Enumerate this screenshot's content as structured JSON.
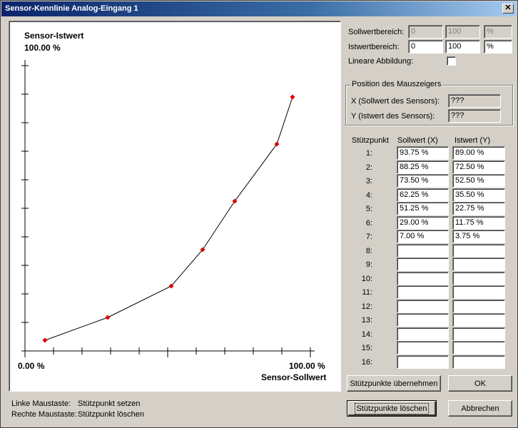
{
  "window": {
    "title": "Sensor-Kennlinie Analog-Eingang 1",
    "close_glyph": "✕"
  },
  "chart_data": {
    "type": "line",
    "title": "",
    "ylabel": "Sensor-Istwert",
    "xlabel": "Sensor-Sollwert",
    "y_top_label": "100.00 %",
    "x_min_label": "0.00 %",
    "x_max_label": "100.00 %",
    "xlim": [
      0,
      100
    ],
    "ylim": [
      0,
      100
    ],
    "grid": false,
    "marker_color": "#e00000",
    "line_color": "#000000",
    "series": [
      {
        "x": [
          93.75,
          88.25,
          73.5,
          62.25,
          51.25,
          29.0,
          7.0
        ],
        "y": [
          89.0,
          72.5,
          52.5,
          35.5,
          22.75,
          11.75,
          3.75
        ]
      }
    ]
  },
  "ranges": {
    "soll_label": "Sollwertbereich:",
    "soll_from": "0",
    "soll_to": "100",
    "soll_unit": "%",
    "ist_label": "Istwertbereich:",
    "ist_from": "0",
    "ist_to": "100",
    "ist_unit": "%",
    "linear_label": "Lineare Abbildung:"
  },
  "mouse": {
    "caption": "Position des Mauszeigers",
    "x_label": "X  (Sollwert des Sensors):",
    "x_value": "???",
    "y_label": "Y  (Istwert des Sensors):",
    "y_value": "???"
  },
  "points": {
    "col_index": "Stützpunkt",
    "col_x": "Sollwert (X)",
    "col_y": "Istwert (Y)",
    "rows": [
      {
        "idx": "1:",
        "x": "93.75 %",
        "y": "89.00 %"
      },
      {
        "idx": "2:",
        "x": "88.25 %",
        "y": "72.50 %"
      },
      {
        "idx": "3:",
        "x": "73.50 %",
        "y": "52.50 %"
      },
      {
        "idx": "4:",
        "x": "62.25 %",
        "y": "35.50 %"
      },
      {
        "idx": "5:",
        "x": "51.25 %",
        "y": "22.75 %"
      },
      {
        "idx": "6:",
        "x": "29.00 %",
        "y": "11.75 %"
      },
      {
        "idx": "7:",
        "x": "7.00 %",
        "y": "3.75 %"
      },
      {
        "idx": "8:",
        "x": "",
        "y": ""
      },
      {
        "idx": "9:",
        "x": "",
        "y": ""
      },
      {
        "idx": "10:",
        "x": "",
        "y": ""
      },
      {
        "idx": "11:",
        "x": "",
        "y": ""
      },
      {
        "idx": "12:",
        "x": "",
        "y": ""
      },
      {
        "idx": "13:",
        "x": "",
        "y": ""
      },
      {
        "idx": "14:",
        "x": "",
        "y": ""
      },
      {
        "idx": "15:",
        "x": "",
        "y": ""
      },
      {
        "idx": "16:",
        "x": "",
        "y": ""
      }
    ]
  },
  "hints": {
    "left_key": "Linke Maustaste:",
    "left_action": "Stützpunkt setzen",
    "right_key": "Rechte Maustaste:",
    "right_action": "Stützpunkt löschen"
  },
  "buttons": {
    "apply": "Stützpunkte übernehmen",
    "ok": "OK",
    "delete": "Stützpunkte löschen",
    "cancel": "Abbrechen"
  }
}
